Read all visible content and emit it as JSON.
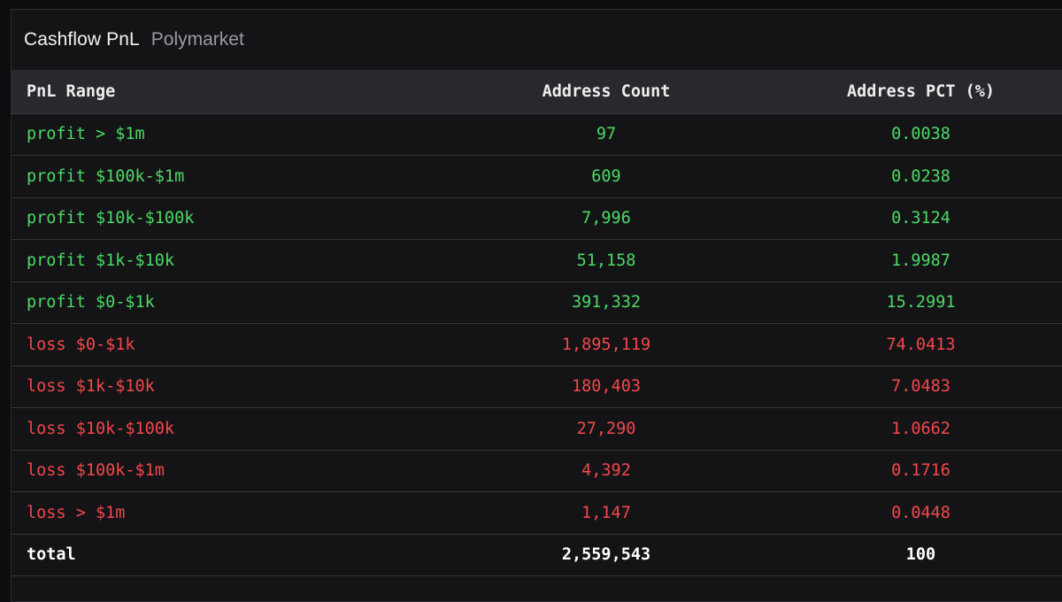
{
  "panel": {
    "title": "Cashflow PnL",
    "subtitle": "Polymarket"
  },
  "table": {
    "headers": [
      "PnL Range",
      "Address Count",
      "Address PCT (%)"
    ],
    "rows": [
      {
        "type": "profit",
        "range": "profit > $1m",
        "count": "97",
        "pct": "0.0038"
      },
      {
        "type": "profit",
        "range": "profit $100k-$1m",
        "count": "609",
        "pct": "0.0238"
      },
      {
        "type": "profit",
        "range": "profit $10k-$100k",
        "count": "7,996",
        "pct": "0.3124"
      },
      {
        "type": "profit",
        "range": "profit $1k-$10k",
        "count": "51,158",
        "pct": "1.9987"
      },
      {
        "type": "profit",
        "range": "profit $0-$1k",
        "count": "391,332",
        "pct": "15.2991"
      },
      {
        "type": "loss",
        "range": "loss $0-$1k",
        "count": "1,895,119",
        "pct": "74.0413"
      },
      {
        "type": "loss",
        "range": "loss $1k-$10k",
        "count": "180,403",
        "pct": "7.0483"
      },
      {
        "type": "loss",
        "range": "loss $10k-$100k",
        "count": "27,290",
        "pct": "1.0662"
      },
      {
        "type": "loss",
        "range": "loss $100k-$1m",
        "count": "4,392",
        "pct": "0.1716"
      },
      {
        "type": "loss",
        "range": "loss > $1m",
        "count": "1,147",
        "pct": "0.0448"
      },
      {
        "type": "total",
        "range": "total",
        "count": "2,559,543",
        "pct": "100"
      }
    ]
  },
  "colors": {
    "profit": "#4cd964",
    "loss": "#f2474a",
    "total": "#ffffff",
    "background": "#141417",
    "header_bg": "#28282d"
  }
}
